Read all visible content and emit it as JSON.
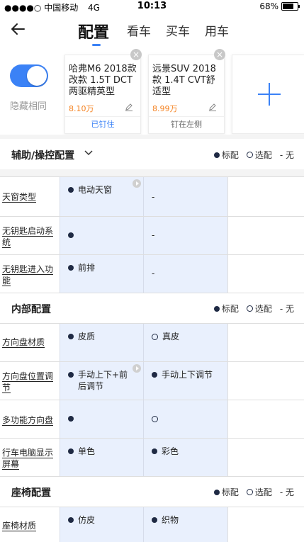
{
  "status_bar": {
    "carrier": "中国移动",
    "network": "4G",
    "time": "10:13",
    "battery": "68%",
    "battery_level": 0.68
  },
  "nav": {
    "tabs": [
      "配置",
      "看车",
      "买车",
      "用车"
    ],
    "active_tab": "配置"
  },
  "toggle": {
    "label": "隐藏相同",
    "on": true
  },
  "cars": [
    {
      "name": "哈弗M6 2018款 改款 1.5T DCT 两驱精英型",
      "price": "8.10万",
      "action": "已钉住",
      "action_color": "#3b82f6"
    },
    {
      "name": "远景SUV 2018款 1.4T CVT舒适型",
      "price": "8.99万",
      "action": "钉在左侧",
      "action_color": "#666666"
    }
  ],
  "legend": {
    "standard": "标配",
    "optional": "选配",
    "none": "- 无"
  },
  "sections": [
    {
      "title": "辅助/操控配置",
      "rows": [
        {
          "label": "天窗类型",
          "c1": "电动天窗",
          "c1_mark": "dot",
          "c2": "-",
          "c2_mark": "none"
        },
        {
          "label": "无钥匙启动系统",
          "c1": "",
          "c1_mark": "dot",
          "c2": "-",
          "c2_mark": "none"
        },
        {
          "label": "无钥匙进入功能",
          "c1": "前排",
          "c1_mark": "dot",
          "c2": "-",
          "c2_mark": "none"
        }
      ]
    },
    {
      "title": "内部配置",
      "rows": [
        {
          "label": "方向盘材质",
          "c1": "皮质",
          "c1_mark": "dot",
          "c2": "真皮",
          "c2_mark": "ring"
        },
        {
          "label": "方向盘位置调节",
          "c1": "手动上下+前后调节",
          "c1_mark": "dot",
          "c2": "手动上下调节",
          "c2_mark": "dot"
        },
        {
          "label": "多功能方向盘",
          "c1": "",
          "c1_mark": "dot",
          "c2": "",
          "c2_mark": "ring"
        },
        {
          "label": "行车电脑显示屏幕",
          "c1": "单色",
          "c1_mark": "dot",
          "c2": "彩色",
          "c2_mark": "dot"
        }
      ]
    },
    {
      "title": "座椅配置",
      "rows": [
        {
          "label": "座椅材质",
          "c1": "仿皮",
          "c1_mark": "dot",
          "c2": "织物",
          "c2_mark": "dot"
        }
      ]
    }
  ]
}
